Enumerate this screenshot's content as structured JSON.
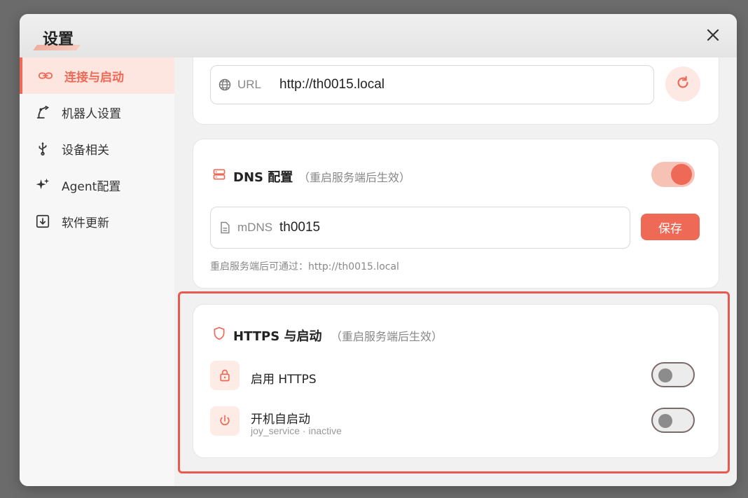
{
  "window": {
    "title": "设置",
    "close_icon": "close-icon"
  },
  "sidebar": {
    "items": [
      {
        "label": "连接与启动",
        "icon": "link-icon",
        "active": true
      },
      {
        "label": "机器人设置",
        "icon": "robot-arm-icon",
        "active": false
      },
      {
        "label": "设备相关",
        "icon": "usb-icon",
        "active": false
      },
      {
        "label": "Agent配置",
        "icon": "sparkle-icon",
        "active": false
      },
      {
        "label": "软件更新",
        "icon": "download-icon",
        "active": false
      }
    ]
  },
  "url_section": {
    "label": "URL",
    "value": "http://th0015.local",
    "refresh_icon": "refresh-icon"
  },
  "dns_section": {
    "title": "DNS 配置",
    "note": "（重启服务端后生效）",
    "toggle_on": true,
    "field_label": "mDNS",
    "field_value": "th0015",
    "save_label": "保存",
    "hint": "重启服务端后可通过：http://th0015.local"
  },
  "https_section": {
    "title": "HTTPS 与启动",
    "note": "（重启服务端后生效）",
    "rows": [
      {
        "label": "启用 HTTPS",
        "sub": "",
        "icon": "lock-icon",
        "toggle_on": false
      },
      {
        "label": "开机自启动",
        "sub": "joy_service · inactive",
        "icon": "power-icon",
        "toggle_on": false
      }
    ]
  },
  "colors": {
    "accent": "#ee6a57",
    "accent_light": "#fde6e0",
    "highlight": "#e85a4f"
  }
}
